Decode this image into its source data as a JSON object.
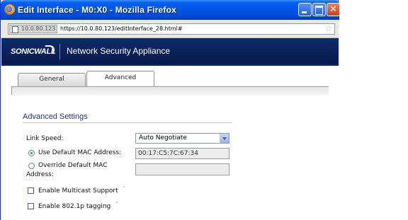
{
  "window": {
    "title": "Edit Interface - M0:X0 - Mozilla Firefox",
    "controls": {
      "minimize": "minimize-icon",
      "maximize": "maximize-icon",
      "close": "✕"
    }
  },
  "urlbar": {
    "site_identity": "10.0.80.123",
    "url": "https://10.0.80.123/editInterface_28.html#",
    "bookmark_icon": "☆"
  },
  "banner": {
    "logo_text": "SONICWALL",
    "product_name": "Network Security Appliance"
  },
  "tabs": [
    {
      "label": "General",
      "active": false
    },
    {
      "label": "Advanced",
      "active": true
    }
  ],
  "advanced": {
    "section_title": "Advanced Settings",
    "link_speed": {
      "label": "Link Speed:",
      "value": "Auto Negotiate"
    },
    "use_default_mac": {
      "label": "Use Default MAC Address:",
      "selected": true,
      "value": "00:17:C5:7C:67:34"
    },
    "override_mac": {
      "label_line1": "Override Default MAC",
      "label_line2": "Address:",
      "selected": false,
      "value": ""
    },
    "multicast": {
      "label": "Enable Multicast Support",
      "checked": false,
      "marker": "'"
    },
    "tagging": {
      "label": "Enable 802.1p tagging",
      "checked": false,
      "marker": "'"
    }
  },
  "colors": {
    "titlebar": "#0056e4",
    "banner": "#0b2460",
    "section_title": "#1a3a78"
  }
}
